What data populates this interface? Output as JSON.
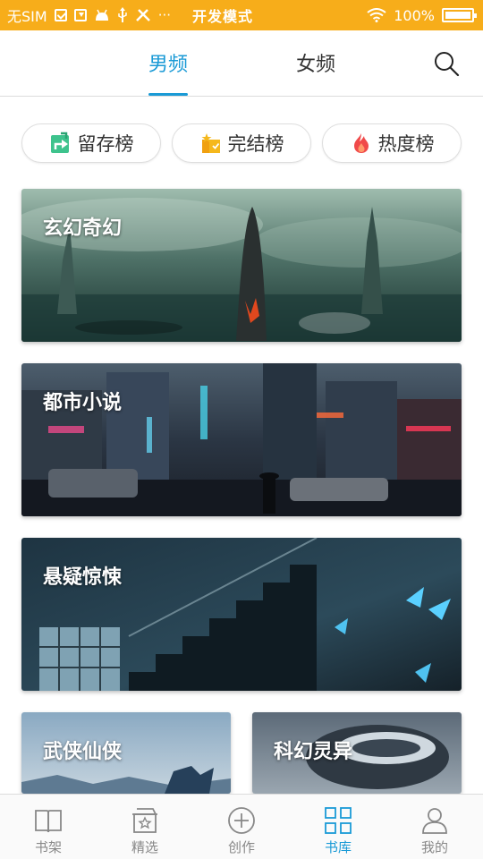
{
  "status_bar": {
    "carrier": "无SIM",
    "mode": "开发模式",
    "battery": "100%",
    "icons": [
      "check-icon",
      "download-icon",
      "android-icon",
      "usb-icon",
      "tools-icon",
      "more-icon",
      "wifi-icon",
      "battery-icon"
    ]
  },
  "header": {
    "tabs": [
      {
        "label": "男频",
        "active": true
      },
      {
        "label": "女频",
        "active": false
      }
    ],
    "search_icon": "search-icon"
  },
  "rankings": [
    {
      "label": "留存榜",
      "icon": "retention-icon"
    },
    {
      "label": "完结榜",
      "icon": "completed-icon"
    },
    {
      "label": "热度榜",
      "icon": "flame-icon"
    }
  ],
  "categories": [
    {
      "title": "玄幻奇幻"
    },
    {
      "title": "都市小说"
    },
    {
      "title": "悬疑惊悚"
    },
    {
      "title": "武侠仙侠"
    },
    {
      "title": "科幻灵异"
    }
  ],
  "bottom_nav": [
    {
      "label": "书架",
      "icon": "bookshelf-icon",
      "active": false
    },
    {
      "label": "精选",
      "icon": "featured-icon",
      "active": false
    },
    {
      "label": "创作",
      "icon": "create-icon",
      "active": false
    },
    {
      "label": "书库",
      "icon": "library-icon",
      "active": true
    },
    {
      "label": "我的",
      "icon": "profile-icon",
      "active": false
    }
  ],
  "colors": {
    "status_bar": "#f7ad1a",
    "accent": "#1a9ad6"
  }
}
